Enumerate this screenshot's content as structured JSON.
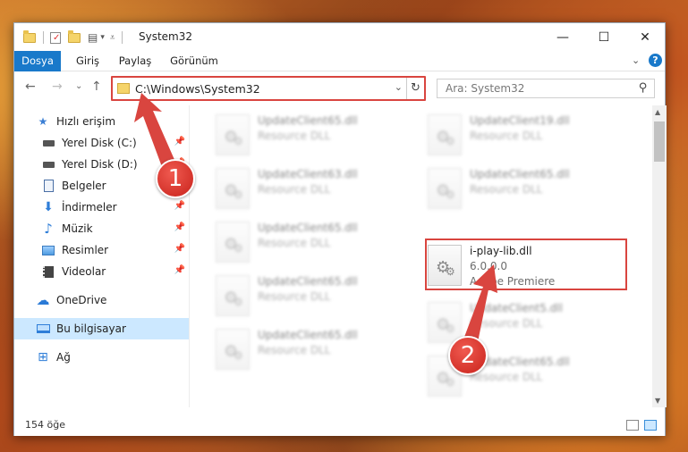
{
  "window": {
    "title": "System32",
    "controls": {
      "minimize": "—",
      "maximize": "☐",
      "close": "✕"
    }
  },
  "ribbon": {
    "tabs": [
      {
        "label": "Dosya",
        "active": true
      },
      {
        "label": "Giriş",
        "active": false
      },
      {
        "label": "Paylaş",
        "active": false
      },
      {
        "label": "Görünüm",
        "active": false
      }
    ],
    "expand": "⌄",
    "help": "?"
  },
  "nav": {
    "back": "←",
    "forward": "→",
    "recent": "⌄",
    "up": "↑",
    "address": "C:\\Windows\\System32",
    "address_dropdown": "⌄",
    "refresh": "↻",
    "search_placeholder": "Ara: System32",
    "search_icon": "⚲"
  },
  "sidebar": {
    "items": [
      {
        "label": "Hızlı erişim",
        "icon": "star-icon",
        "glyph": "★",
        "color": "#3b7fd4",
        "pinned": false,
        "selected": false
      },
      {
        "label": "Yerel Disk (C:)",
        "icon": "drive-icon",
        "glyph": "▬",
        "color": "#3a3a3a",
        "pinned": true,
        "selected": false
      },
      {
        "label": "Yerel Disk (D:)",
        "icon": "drive-icon",
        "glyph": "▬",
        "color": "#3a3a3a",
        "pinned": true,
        "selected": false
      },
      {
        "label": "Belgeler",
        "icon": "document-icon",
        "glyph": "▤",
        "color": "#4a6fa5",
        "pinned": true,
        "selected": false
      },
      {
        "label": "İndirmeler",
        "icon": "download-icon",
        "glyph": "⬇",
        "color": "#2f7ed8",
        "pinned": true,
        "selected": false
      },
      {
        "label": "Müzik",
        "icon": "music-icon",
        "glyph": "♪",
        "color": "#2f7ed8",
        "pinned": true,
        "selected": false
      },
      {
        "label": "Resimler",
        "icon": "pictures-icon",
        "glyph": "▣",
        "color": "#3a7bbf",
        "pinned": true,
        "selected": false
      },
      {
        "label": "Videolar",
        "icon": "video-icon",
        "glyph": "▦",
        "color": "#444",
        "pinned": true,
        "selected": false
      },
      {
        "label": "OneDrive",
        "icon": "cloud-icon",
        "glyph": "☁",
        "color": "#2a7ad6",
        "pinned": false,
        "selected": false
      },
      {
        "label": "Bu bilgisayar",
        "icon": "computer-icon",
        "glyph": "▭",
        "color": "#2f7ed8",
        "pinned": false,
        "selected": true
      },
      {
        "label": "Ağ",
        "icon": "network-icon",
        "glyph": "⊞",
        "color": "#2f7ed8",
        "pinned": false,
        "selected": false
      }
    ],
    "pin_glyph": "📌"
  },
  "files": {
    "col1": [
      {
        "name": "UpdateClient65.dll",
        "type": "Resource DLL"
      },
      {
        "name": "UpdateClient63.dll",
        "type": "Resource DLL"
      },
      {
        "name": "UpdateClient65.dll",
        "type": "Resource DLL"
      },
      {
        "name": "UpdateClient65.dll",
        "type": "Resource DLL"
      },
      {
        "name": "UpdateClient65.dll",
        "type": "Resource DLL"
      }
    ],
    "col2": [
      {
        "name": "UpdateClient19.dll",
        "type": "Resource DLL"
      },
      {
        "name": "UpdateClient65.dll",
        "type": "Resource DLL"
      },
      {
        "name": "UpdateClient5.dll",
        "type": "Resource DLL"
      },
      {
        "name": "UpdateClient65.dll",
        "type": "Resource DLL"
      }
    ],
    "selected": {
      "name": "i-play-lib.dll",
      "version": "6.0.0.0",
      "company": "Adobe Premiere"
    }
  },
  "status": {
    "count": "154 öğe"
  },
  "annotations": {
    "badge1": "1",
    "badge2": "2",
    "color": "#d9453f"
  }
}
